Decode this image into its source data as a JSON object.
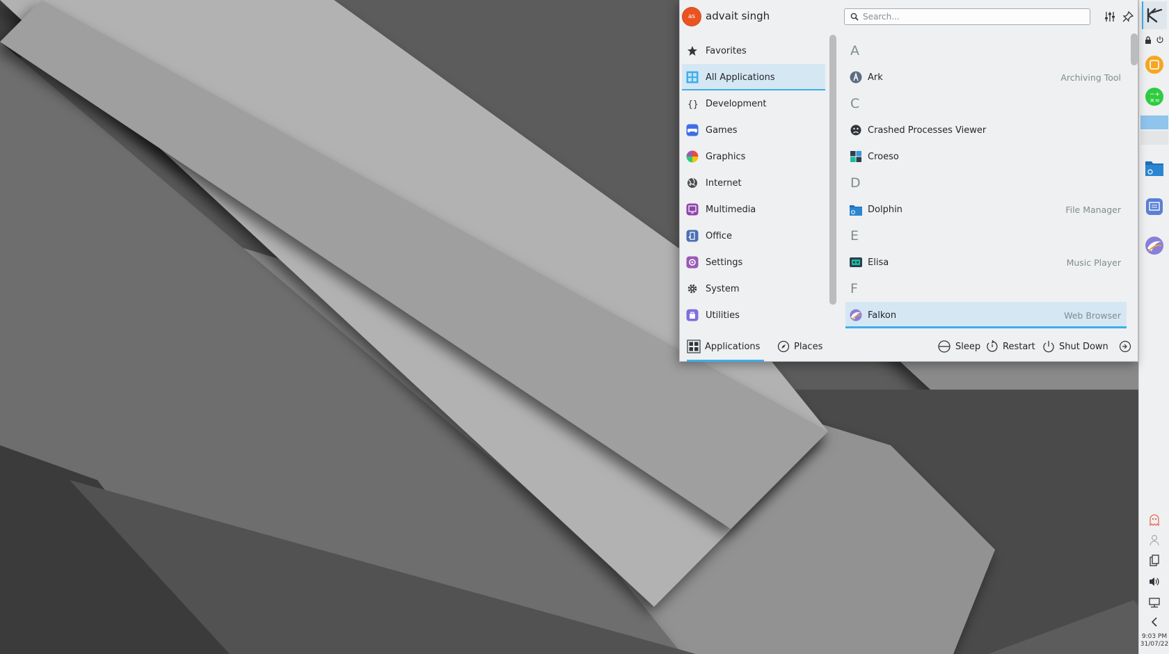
{
  "user": {
    "name": "advait singh",
    "initials": "as"
  },
  "search": {
    "placeholder": "Search..."
  },
  "categories": [
    {
      "label": "Favorites",
      "icon": "star-icon"
    },
    {
      "label": "All Applications",
      "icon": "grid-icon",
      "active": true
    },
    {
      "label": "Development",
      "icon": "braces-icon"
    },
    {
      "label": "Games",
      "icon": "gamepad-icon"
    },
    {
      "label": "Graphics",
      "icon": "color-wheel-icon"
    },
    {
      "label": "Internet",
      "icon": "globe-icon"
    },
    {
      "label": "Multimedia",
      "icon": "multimedia-icon"
    },
    {
      "label": "Office",
      "icon": "office-icon"
    },
    {
      "label": "Settings",
      "icon": "settings-icon"
    },
    {
      "label": "System",
      "icon": "gear-icon"
    },
    {
      "label": "Utilities",
      "icon": "utilities-icon"
    }
  ],
  "apps": {
    "sections": {
      "a": "A",
      "c": "C",
      "d": "D",
      "e": "E",
      "f": "F"
    },
    "items": [
      {
        "name": "Ark",
        "desc": "Archiving Tool",
        "icon": "ark-icon"
      },
      {
        "name": "Crashed Processes Viewer",
        "desc": "",
        "icon": "sad-face-icon"
      },
      {
        "name": "Croeso",
        "desc": "",
        "icon": "croeso-icon"
      },
      {
        "name": "Dolphin",
        "desc": "File Manager",
        "icon": "folder-icon"
      },
      {
        "name": "Elisa",
        "desc": "Music Player",
        "icon": "elisa-icon"
      },
      {
        "name": "Falkon",
        "desc": "Web Browser",
        "icon": "falkon-icon",
        "active": true
      }
    ]
  },
  "footer": {
    "applications": "Applications",
    "places": "Places",
    "sleep": "Sleep",
    "restart": "Restart",
    "shutdown": "Shut Down"
  },
  "panel": {
    "clock_time": "9:03 PM",
    "clock_date": "31/07/22"
  },
  "colors": {
    "accent": "#3daee9",
    "highlight": "#d6e7f4",
    "avatar": "#e95420",
    "panel": "#eff0f1"
  }
}
